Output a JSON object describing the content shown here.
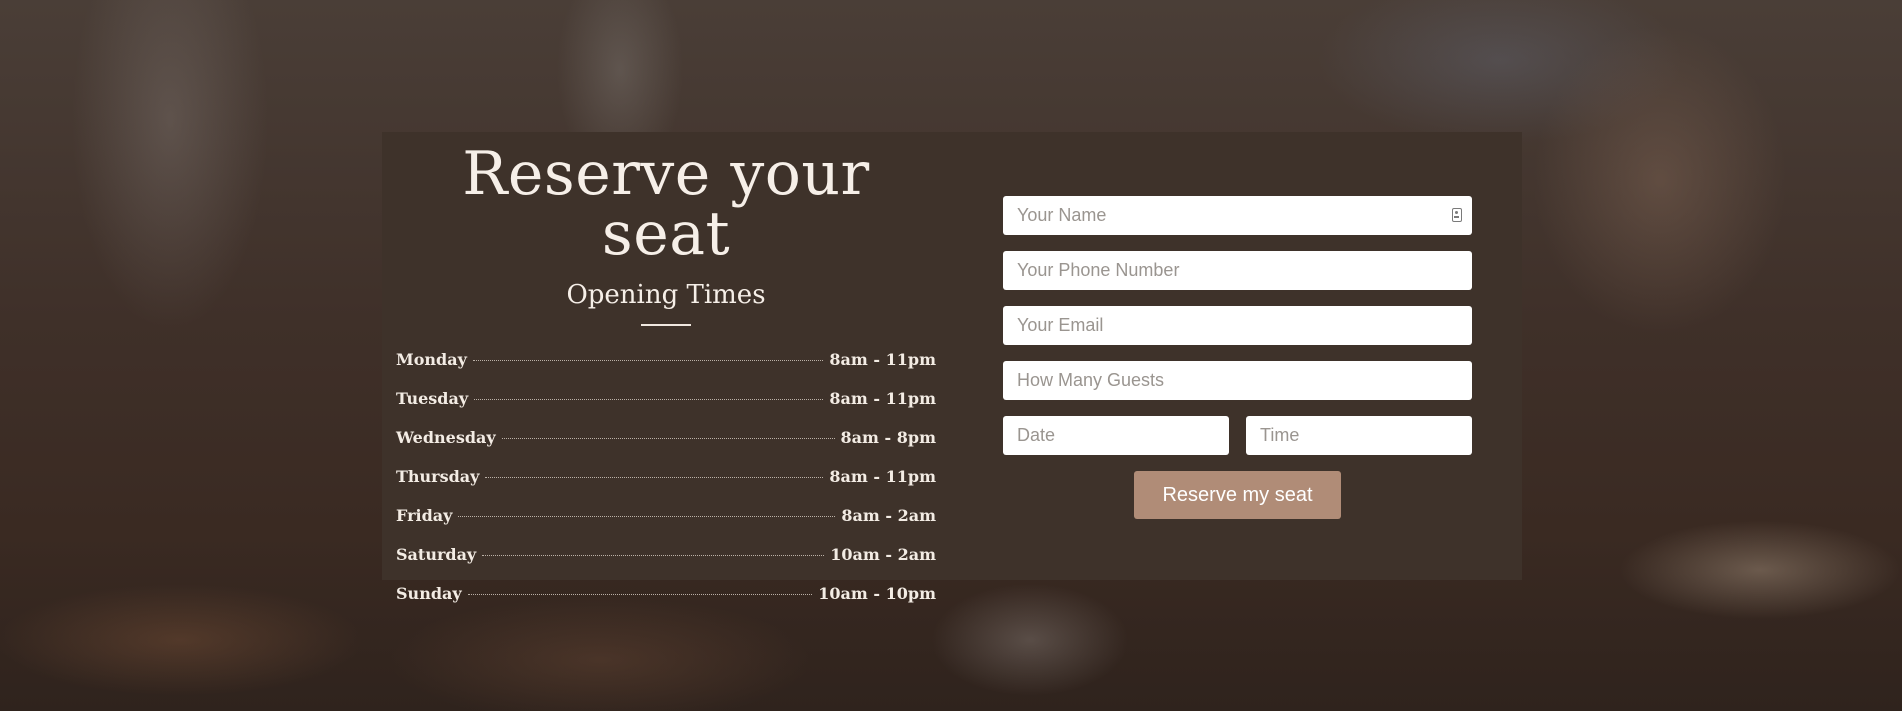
{
  "reservation": {
    "title": "Reserve your seat",
    "opening_times_heading": "Opening Times",
    "hours": [
      {
        "day": "Monday",
        "time": "8am - 11pm"
      },
      {
        "day": "Tuesday",
        "time": "8am - 11pm"
      },
      {
        "day": "Wednesday",
        "time": "8am - 8pm"
      },
      {
        "day": "Thursday",
        "time": "8am - 11pm"
      },
      {
        "day": "Friday",
        "time": "8am - 2am"
      },
      {
        "day": "Saturday",
        "time": "10am - 2am"
      },
      {
        "day": "Sunday",
        "time": "10am - 10pm"
      }
    ]
  },
  "form": {
    "name": {
      "placeholder": "Your Name",
      "value": ""
    },
    "phone": {
      "placeholder": "Your Phone Number",
      "value": ""
    },
    "email": {
      "placeholder": "Your Email",
      "value": ""
    },
    "guests": {
      "placeholder": "How Many Guests",
      "value": ""
    },
    "date": {
      "placeholder": "Date",
      "value": ""
    },
    "time": {
      "placeholder": "Time",
      "value": ""
    },
    "submit_label": "Reserve my seat"
  },
  "icons": {
    "name_field_icon": "contact-card-icon"
  },
  "colors": {
    "card_background": "#3e322a",
    "button_background": "#b08c77",
    "text_light": "#f6efe8"
  }
}
